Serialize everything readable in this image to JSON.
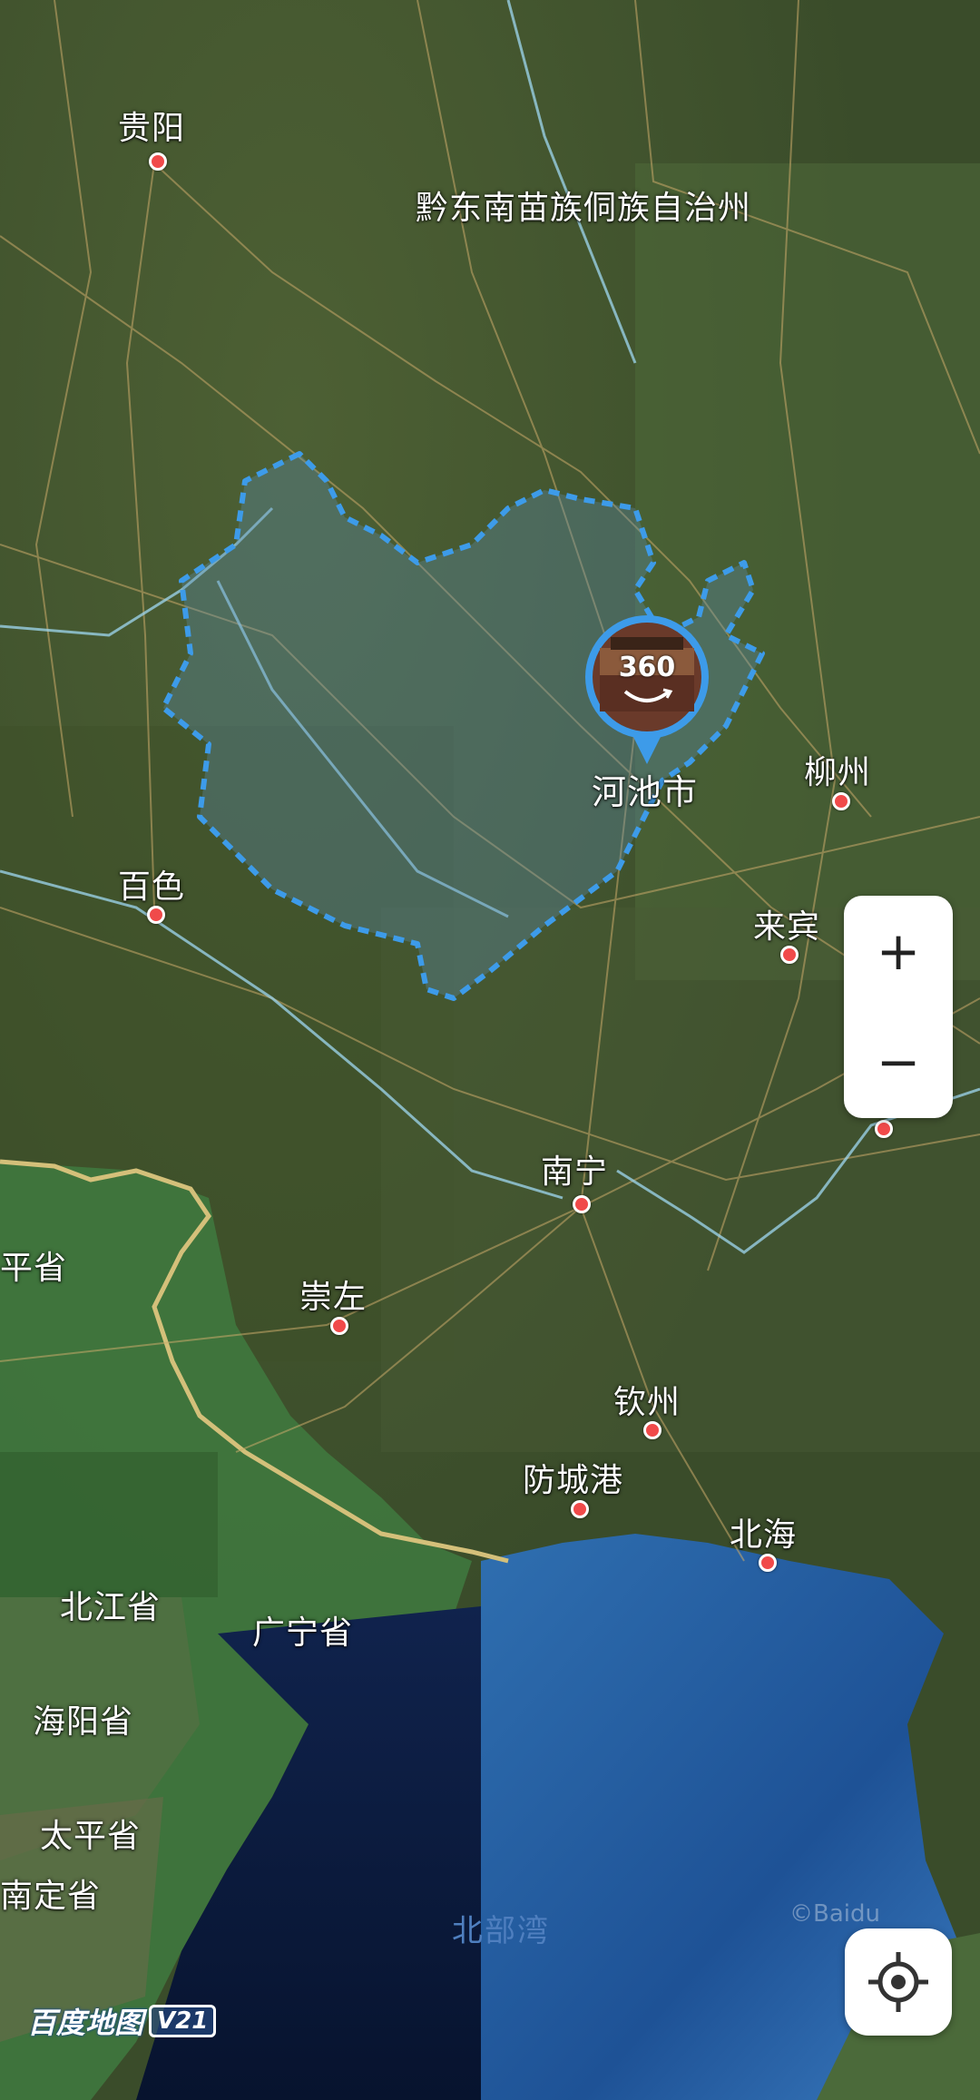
{
  "map": {
    "region_label": "黔东南苗族侗族自治州",
    "sea_label": "北部湾",
    "highlight_color": "#3d9be9",
    "highlight_region": "河池市",
    "cities": {
      "guiyang": "贵阳",
      "hechi": "河池市",
      "liuzhou": "柳州",
      "baise": "百色",
      "laibin": "来宾",
      "nanning": "南宁",
      "chongzuo": "崇左",
      "qinzhou": "钦州",
      "fangchenggang": "防城港",
      "beihai": "北海"
    },
    "provinces": {
      "pingsheng": "平省",
      "beijiang": "北江省",
      "guangning": "广宁省",
      "haiyang": "海阳省",
      "taiping": "太平省",
      "nanding": "南定省"
    },
    "pano_badge": "360"
  },
  "controls": {
    "zoom_in": "+",
    "zoom_out": "−"
  },
  "brand": {
    "name": "百度地图",
    "version": "V21",
    "watermark": "©Baidu"
  }
}
